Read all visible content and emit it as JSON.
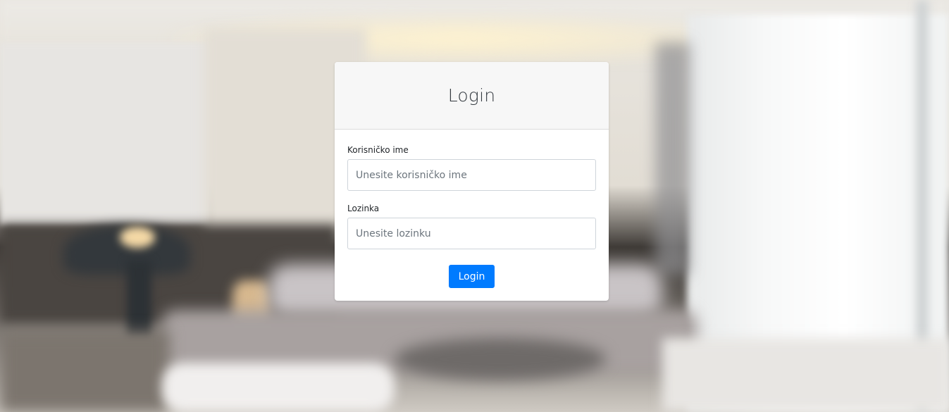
{
  "login_card": {
    "title": "Login",
    "username": {
      "label": "Korisničko ime",
      "placeholder": "Unesite korisničko ime",
      "value": ""
    },
    "password": {
      "label": "Lozinka",
      "placeholder": "Unesite lozinku",
      "value": ""
    },
    "submit_label": "Login"
  },
  "colors": {
    "primary": "#007bff",
    "header_bg": "#f7f7f7",
    "card_bg": "#ffffff"
  }
}
